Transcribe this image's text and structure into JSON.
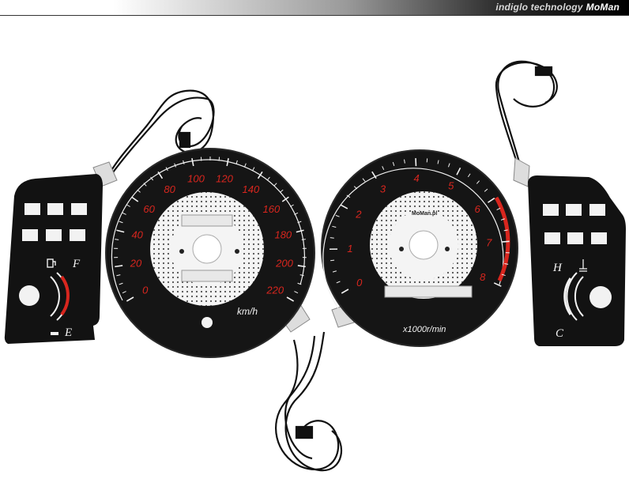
{
  "banner": {
    "prefix": "indiglo technology",
    "brand": "MoMan"
  },
  "speedometer": {
    "ticks": [
      "0",
      "20",
      "40",
      "60",
      "80",
      "100",
      "120",
      "140",
      "160",
      "180",
      "200",
      "220"
    ],
    "unit": "km/h"
  },
  "tachometer": {
    "ticks": [
      "0",
      "1",
      "2",
      "3",
      "4",
      "5",
      "6",
      "7",
      "8"
    ],
    "unit": "x1000r/min",
    "logo": "MoMan.pl"
  },
  "fuel_gauge": {
    "full": "F",
    "empty": "E"
  },
  "temp_gauge": {
    "hot": "H",
    "cold": "C"
  },
  "colors": {
    "dial_face": "#111111",
    "numerals_red": "#d8261e",
    "center_white": "#f4f4f4",
    "banner_dark": "#000000"
  }
}
